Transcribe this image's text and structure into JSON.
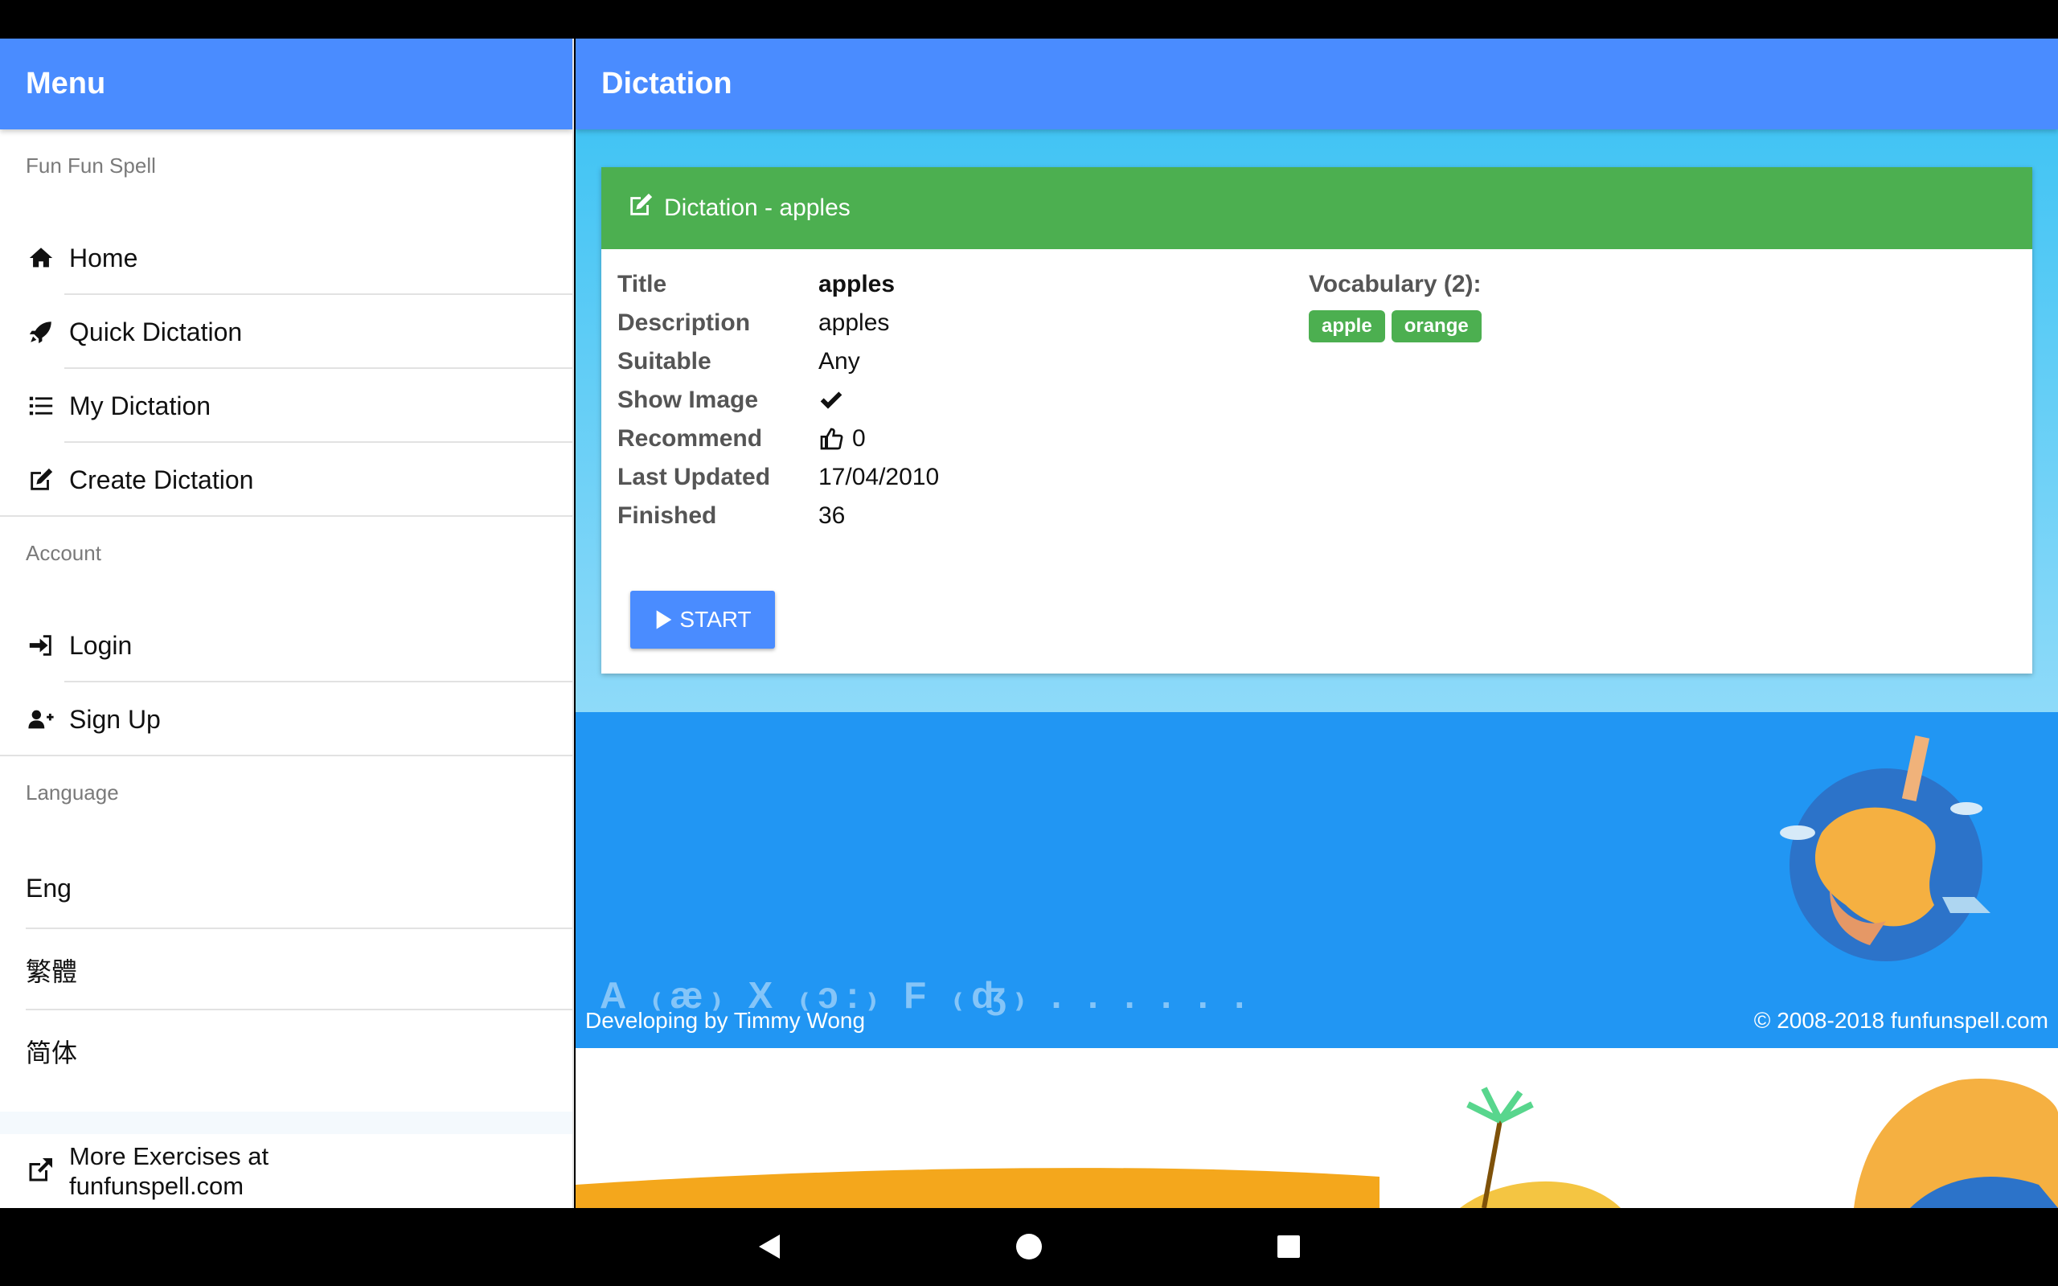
{
  "sidebar": {
    "title": "Menu",
    "brand": "Fun Fun Spell",
    "nav": [
      {
        "label": "Home",
        "icon": "home-icon"
      },
      {
        "label": "Quick Dictation",
        "icon": "rocket-icon"
      },
      {
        "label": "My Dictation",
        "icon": "list-icon"
      },
      {
        "label": "Create Dictation",
        "icon": "edit-icon"
      }
    ],
    "account_label": "Account",
    "account": [
      {
        "label": "Login",
        "icon": "sign-in-icon"
      },
      {
        "label": "Sign Up",
        "icon": "user-plus-icon"
      }
    ],
    "language_label": "Language",
    "languages": [
      "Eng",
      "繁體",
      "简体"
    ],
    "more_line1": "More Exercises at",
    "more_line2": "funfunspell.com"
  },
  "main": {
    "title": "Dictation",
    "card": {
      "header": "Dictation - apples",
      "labels": {
        "title": "Title",
        "description": "Description",
        "suitable": "Suitable",
        "show_image": "Show Image",
        "recommend": "Recommend",
        "last_updated": "Last Updated",
        "finished": "Finished"
      },
      "values": {
        "title": "apples",
        "description": "apples",
        "suitable": "Any",
        "show_image": true,
        "recommend": "0",
        "last_updated": "17/04/2010",
        "finished": "36"
      },
      "vocab_title": "Vocabulary (2):",
      "vocab": [
        "apple",
        "orange"
      ],
      "start_label": "START"
    },
    "footer": {
      "phonetic": "A ₍æ₎ X ₍ɔ:₎ F ₍ʤ₎ . . . . . .",
      "left": "Developing by Timmy Wong",
      "right": "© 2008-2018 funfunspell.com"
    }
  },
  "colors": {
    "primary": "#4a8cff",
    "success": "#4caf50",
    "footer": "#2196f3",
    "sky": "#42c4f4"
  }
}
